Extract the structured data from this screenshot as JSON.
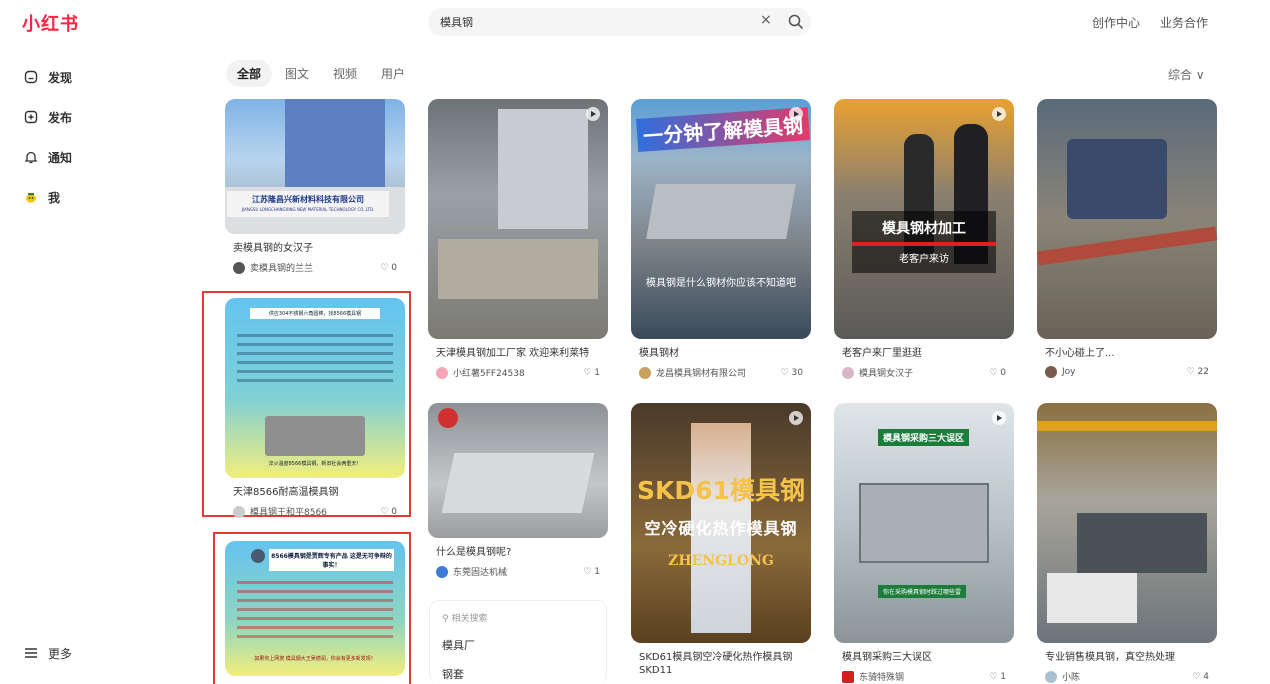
{
  "header": {
    "logo": "小红书",
    "search_query": "模具钢",
    "clear_icon": "×",
    "nav": [
      "创作中心",
      "业务合作"
    ]
  },
  "sidebar": {
    "items": [
      {
        "label": "发现",
        "icon": "discover-icon"
      },
      {
        "label": "发布",
        "icon": "publish-icon"
      },
      {
        "label": "通知",
        "icon": "bell-icon"
      },
      {
        "label": "我",
        "icon": "me-icon"
      }
    ],
    "more": "更多"
  },
  "tabs": [
    "全部",
    "图文",
    "视频",
    "用户"
  ],
  "sort": "综合 ∨",
  "cards": [
    {
      "title": "卖模具钢的女汉子",
      "author": "卖模具钢的兰兰",
      "likes": "0",
      "sign_text": "江苏隆昌兴新材料科技有限公司",
      "sign_sub": "JIANGSU LONGCHANGXING NEW MATERIAL TECHNOLOGY CO.,LTD."
    },
    {
      "title": "天津8566耐高温模具钢",
      "author": "模具钢王和平8566",
      "likes": "0",
      "img_head": "供应304不锈钢六角圆棒，找8566模具钢",
      "img_foot": "淬火温度8566模具钢，新旧社会两重天！"
    },
    {
      "title": "",
      "author": "",
      "likes": "",
      "img_head": "8566模具钢是贾辉专有产品 这是无可争辩的事实！",
      "img_foot": "如果你上网搜 模具钢大王吴德润，你会有更多新发现！"
    },
    {
      "title": "天津模具钢加工厂家 欢迎来利莱特",
      "author": "小红薯5FF24538",
      "likes": "1"
    },
    {
      "title": "什么是模具钢呢?",
      "author": "东莞固达机械",
      "likes": "1"
    },
    {
      "title": "模具钢材",
      "author": "龙昌模具钢材有限公司",
      "likes": "30",
      "img_top": "一分钟了解模具钢",
      "img_text": "模具钢是什么钢材你应该不知道吧"
    },
    {
      "title": "SKD61模具钢空冷硬化热作模具钢SKD11",
      "author": "",
      "likes": "",
      "img_big": "SKD61模具钢",
      "img_mid": "空冷硬化热作模具钢",
      "img_brand": "ZHENGLONG"
    },
    {
      "title": "老客户来厂里逛逛",
      "author": "模具钢女汉子",
      "likes": "0",
      "img_band": "模具钢材加工",
      "img_sub": "老客户来访"
    },
    {
      "title": "模具钢采购三大误区",
      "author": "东骑特殊钢",
      "likes": "1",
      "img_band": "模具钢采购三大误区",
      "img_sub": "你在采购模具钢时踩过哪些雷"
    },
    {
      "title": "不小心碰上了...",
      "author": "Joy",
      "likes": "22"
    },
    {
      "title": "专业销售模具钢，真空热处理",
      "author": "小陈",
      "likes": "4"
    }
  ],
  "related": {
    "header": "相关搜索",
    "items": [
      "模具厂",
      "钢套"
    ]
  }
}
